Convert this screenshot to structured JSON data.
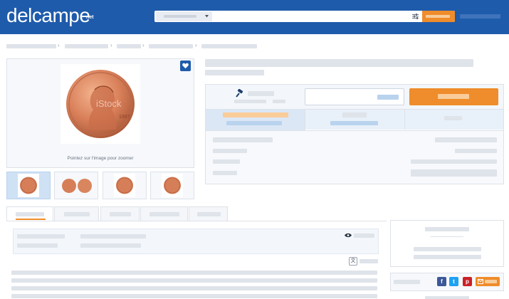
{
  "header": {
    "logo_text": "delcampe",
    "logo_suffix": "net",
    "search": {
      "placeholder": ""
    }
  },
  "product": {
    "zoom_hint": "Pointez sur l'image pour zoomer",
    "image_watermark": "iStock"
  },
  "icons": {
    "favorite": "heart-icon",
    "bid": "gavel-icon",
    "views": "eye-icon",
    "translate": "translate-icon",
    "filter": "sliders-icon",
    "share": [
      "facebook-icon",
      "twitter-icon",
      "pinterest-icon",
      "email-icon"
    ]
  },
  "colors": {
    "brand_blue": "#1f5bab",
    "action_orange": "#ef8c2b",
    "placeholder_gray": "#dfe3ea",
    "placeholder_blue": "#b9d3ee",
    "facebook": "#3b5998",
    "twitter": "#1da1f2",
    "pinterest": "#cb2027"
  }
}
